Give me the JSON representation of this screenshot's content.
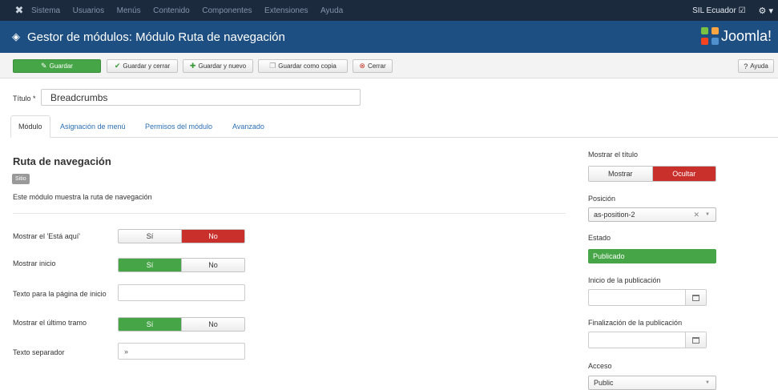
{
  "topbar": {
    "menu": [
      "Sistema",
      "Usuarios",
      "Menús",
      "Contenido",
      "Componentes",
      "Extensiones",
      "Ayuda"
    ],
    "site_link": "SIL Ecuador ☑",
    "gear": "⚙ ▾"
  },
  "header": {
    "title": "Gestor de módulos: Módulo Ruta de navegación",
    "brand": "Joomla!"
  },
  "toolbar": {
    "save": "Guardar",
    "save_close": "Guardar y cerrar",
    "save_new": "Guardar y nuevo",
    "save_copy": "Guardar como copia",
    "close": "Cerrar",
    "help": "Ayuda"
  },
  "form": {
    "title_label": "Título *",
    "title_value": "Breadcrumbs"
  },
  "tabs": [
    "Módulo",
    "Asignación de menú",
    "Permisos del módulo",
    "Avanzado"
  ],
  "module": {
    "name": "Ruta de navegación",
    "badge": "Sitio",
    "description": "Este módulo muestra la ruta de navegación"
  },
  "options": {
    "show_here_label": "Mostrar el 'Está aquí'",
    "show_home_label": "Mostrar inicio",
    "home_text_label": "Texto para la página de inicio",
    "home_text_value": "",
    "show_last_label": "Mostrar el último tramo",
    "separator_label": "Texto separador",
    "separator_value": "»",
    "yes": "Sí",
    "no": "No"
  },
  "sidebar": {
    "show_title_label": "Mostrar el título",
    "show": "Mostrar",
    "hide": "Ocultar",
    "position_label": "Posición",
    "position_value": "as-position-2",
    "state_label": "Estado",
    "state_value": "Publicado",
    "publish_up_label": "Inicio de la publicación",
    "publish_down_label": "Finalización de la publicación",
    "access_label": "Acceso",
    "access_value": "Public"
  },
  "colors": {
    "topbar": "#1b2a3d",
    "header": "#1d4f82",
    "green": "#46a546",
    "red": "#c9302c"
  }
}
